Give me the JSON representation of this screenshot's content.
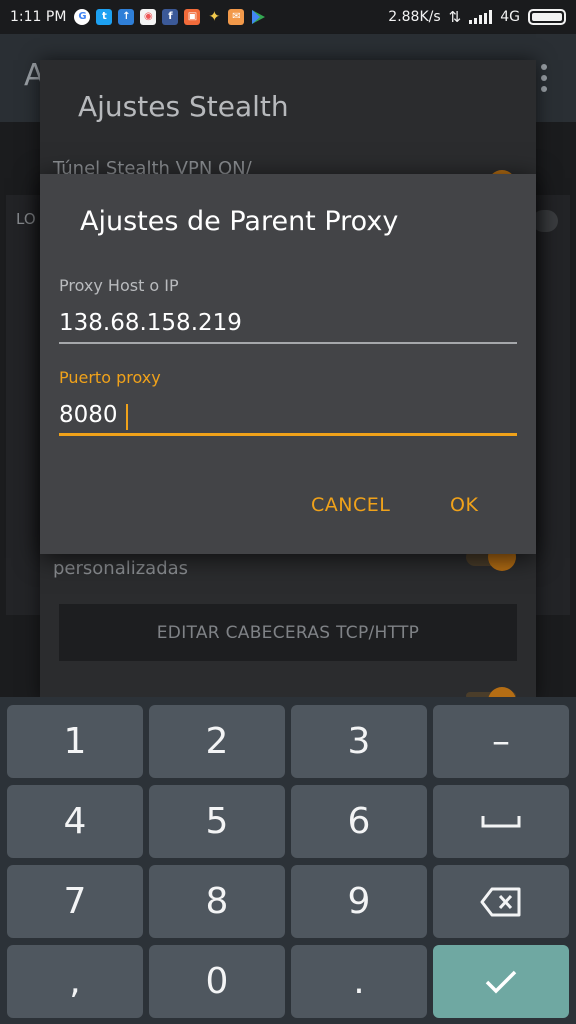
{
  "status_bar": {
    "time": "1:11 PM",
    "network_speed": "2.88K/s",
    "network_type": "4G",
    "notification_icons": [
      "google-icon",
      "twitter-icon",
      "app-icon",
      "calendar-icon",
      "facebook-icon",
      "photo-icon",
      "pinwheel-icon",
      "mail-icon",
      "play-store-icon"
    ]
  },
  "background_app": {
    "title": "A",
    "label_partial": "LO"
  },
  "stealth_dialog": {
    "title": "Ajustes Stealth",
    "row1_label": "Túnel Stealth VPN ON/",
    "row2_label": "personalizadas",
    "edit_button": "EDITAR CABECERAS TCP/HTTP"
  },
  "proxy_dialog": {
    "title": "Ajustes de Parent Proxy",
    "host_label": "Proxy Host o IP",
    "host_value": "138.68.158.219",
    "port_label": "Puerto proxy",
    "port_value": "8080",
    "cancel_label": "CANCEL",
    "ok_label": "OK"
  },
  "keyboard": {
    "keys": [
      "1",
      "2",
      "3",
      "–",
      "4",
      "5",
      "6",
      "␣",
      "7",
      "8",
      "9",
      "⌫",
      ",",
      "0",
      ".",
      "✓"
    ]
  },
  "colors": {
    "accent": "#f0a21a",
    "dialog_bg": "#434447",
    "keyboard_bg": "#2c3238",
    "key_bg": "#4f575f",
    "done_key_bg": "#6fa8a2"
  }
}
